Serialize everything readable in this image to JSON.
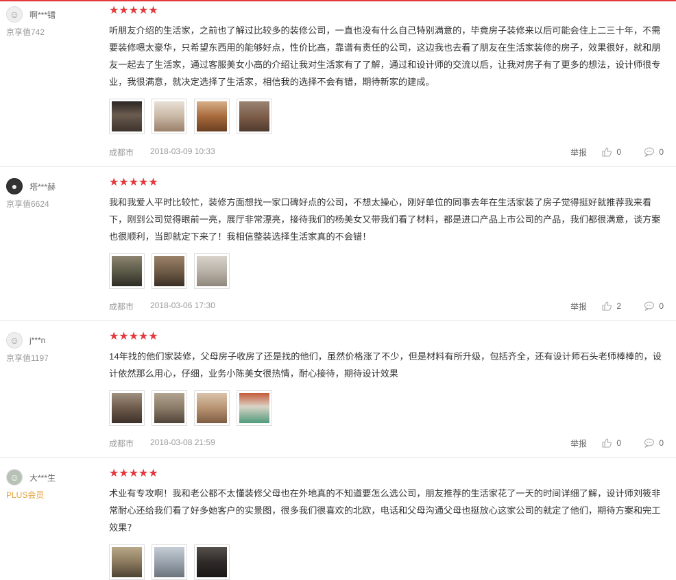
{
  "reviews": [
    {
      "user": "啊***镭",
      "level": "京享值742",
      "text": "听朋友介绍的生活家，之前也了解过比较多的装修公司，一直也没有什么自己特别满意的，毕竟房子装修来以后可能会住上二三十年，不需要装修嗯太豪华，只希望东西用的能够好点，性价比高，靠谱有责任的公司，这边我也去看了朋友在生活家装修的房子，效果很好，就和朋友一起去了生活家，通过客服美女小高的介绍让我对生活家有了了解，通过和设计师的交流以后，让我对房子有了更多的想法，设计师很专业，我很满意，就决定选择了生活家，相信我的选择不会有错，期待新家的建成。",
      "location": "成都市",
      "date": "2018-03-09 10:33",
      "report": "举报",
      "likes": "0",
      "comments": "0",
      "stars": 5,
      "thumb_colors": [
        "#4a3f38",
        "#c9b8a6",
        "#a86a3c",
        "#7a5a45"
      ]
    },
    {
      "user": "塔***赫",
      "level": "京享值6624",
      "text": "我和我爱人平时比较忙，装修方面想找一家口碑好点的公司，不想太操心，刚好单位的同事去年在生活家装了房子觉得挺好就推荐我来看下，刚到公司觉得眼前一亮，展厅非常漂亮，接待我们的杨美女又带我们看了材料，都是进口产品上市公司的产品，我们都很满意，谈方案也很顺利，当即就定下来了！我相信整装选择生活家真的不会错！",
      "location": "成都市",
      "date": "2018-03-06 17:30",
      "report": "举报",
      "likes": "2",
      "comments": "0",
      "stars": 5,
      "thumb_colors": [
        "#5c5a48",
        "#6b5844",
        "#b9b2a8"
      ]
    },
    {
      "user": "j***n",
      "level": "京享值1197",
      "text": "14年找的他们家装修，父母房子收房了还是找的他们，虽然价格涨了不少，但是材料有所升级，包括齐全，还有设计师石头老师棒棒的，设计依然那么用心，仔细，业务小陈美女很热情，耐心接待，期待设计效果",
      "location": "成都市",
      "date": "2018-03-08 21:59",
      "report": "举报",
      "likes": "0",
      "comments": "0",
      "stars": 5,
      "thumb_colors": [
        "#6d5a4b",
        "#8a7a68",
        "#b89372",
        "#4f9a7a"
      ]
    },
    {
      "user": "大***生",
      "level": "PLUS会员",
      "text": "术业有专攻啊！我和老公都不太懂装修父母也在外地真的不知道要怎么选公司，朋友推荐的生活家花了一天的时间详细了解，设计师刘筱非常耐心还给我们看了好多她客户的实景图，很多我们很喜欢的北欧，电话和父母沟通父母也挺放心这家公司的就定了他们，期待方案和完工效果？",
      "location": "",
      "date": "",
      "report": "",
      "likes": "",
      "comments": "",
      "stars": 5,
      "thumb_colors": [
        "#8b7a5e",
        "#9aa3ad",
        "#2f2a28"
      ]
    }
  ],
  "colors": {
    "accent": "#e4393c",
    "muted": "#999999",
    "plus": "#e6a23c"
  },
  "icons": {
    "star": "star-icon",
    "like": "thumbs-up-icon",
    "comment": "comment-bubble-icon"
  }
}
